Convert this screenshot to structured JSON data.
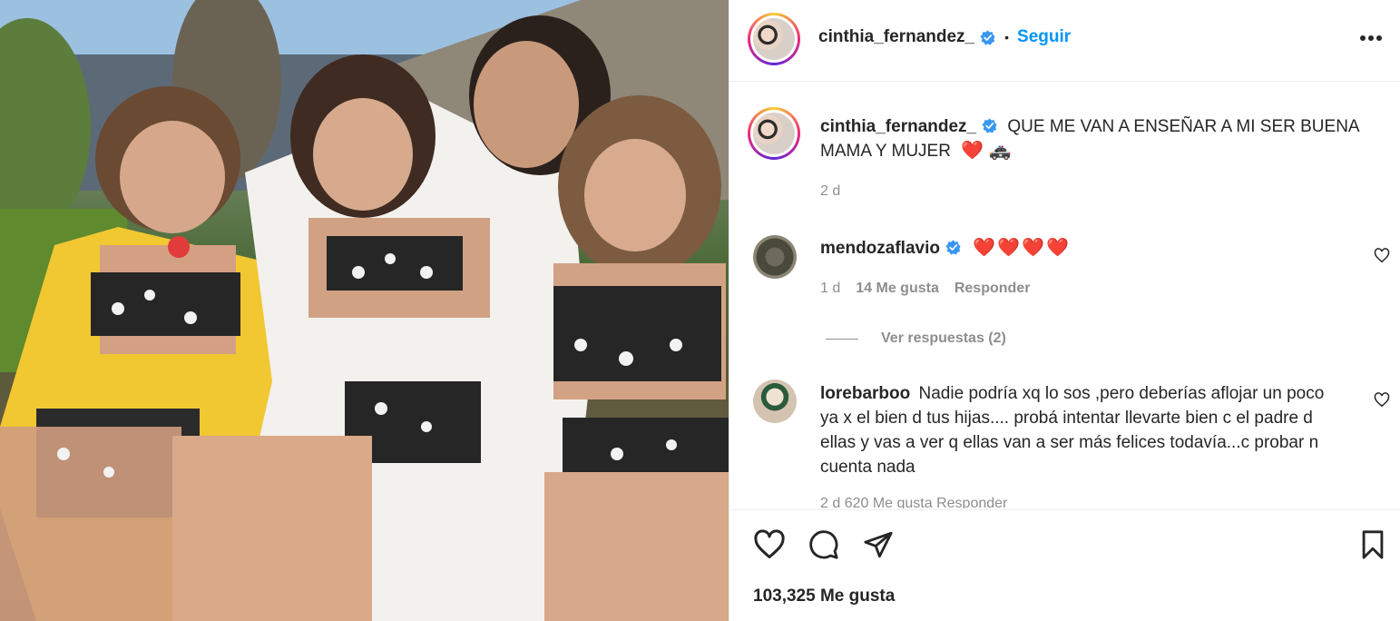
{
  "post": {
    "photo_alt": "Foto",
    "author": {
      "username": "cinthia_fernandez_",
      "verified": true
    },
    "follow_label": "Seguir",
    "dot_separator": "•",
    "caption": {
      "username": "cinthia_fernandez_",
      "text": "QUE ME VAN A ENSEÑAR A MI SER BUENA MAMA Y MUJER",
      "emojis": "❤️ 🚓",
      "time": "2 d"
    },
    "comments": [
      {
        "username": "mendozaflavio",
        "verified": true,
        "text": "❤️❤️❤️❤️",
        "time": "1 d",
        "likes": "14 Me gusta",
        "reply_label": "Responder",
        "view_replies": "Ver respuestas (2)"
      },
      {
        "username": "lorebarboo",
        "verified": false,
        "text": "Nadie podría xq lo sos ,pero deberías aflojar un poco ya x el bien d tus hijas.... probá intentar llevarte bien c el padre d ellas y vas a ver q ellas van a ser más felices todavía...c probar n cuenta nada",
        "partial_meta": "2 d   620 Me gusta   Responder"
      }
    ],
    "like_count": "103,325 Me gusta"
  },
  "colors": {
    "accent": "#0095f6",
    "text": "#262626",
    "muted": "#8e8e8e",
    "divider": "#efefef",
    "heart": "#ed4956",
    "verified": "#3897f0"
  },
  "icons": {
    "more": "more-options-icon",
    "like": "heart-icon",
    "comment": "comment-icon",
    "share": "share-icon",
    "save": "bookmark-icon"
  }
}
